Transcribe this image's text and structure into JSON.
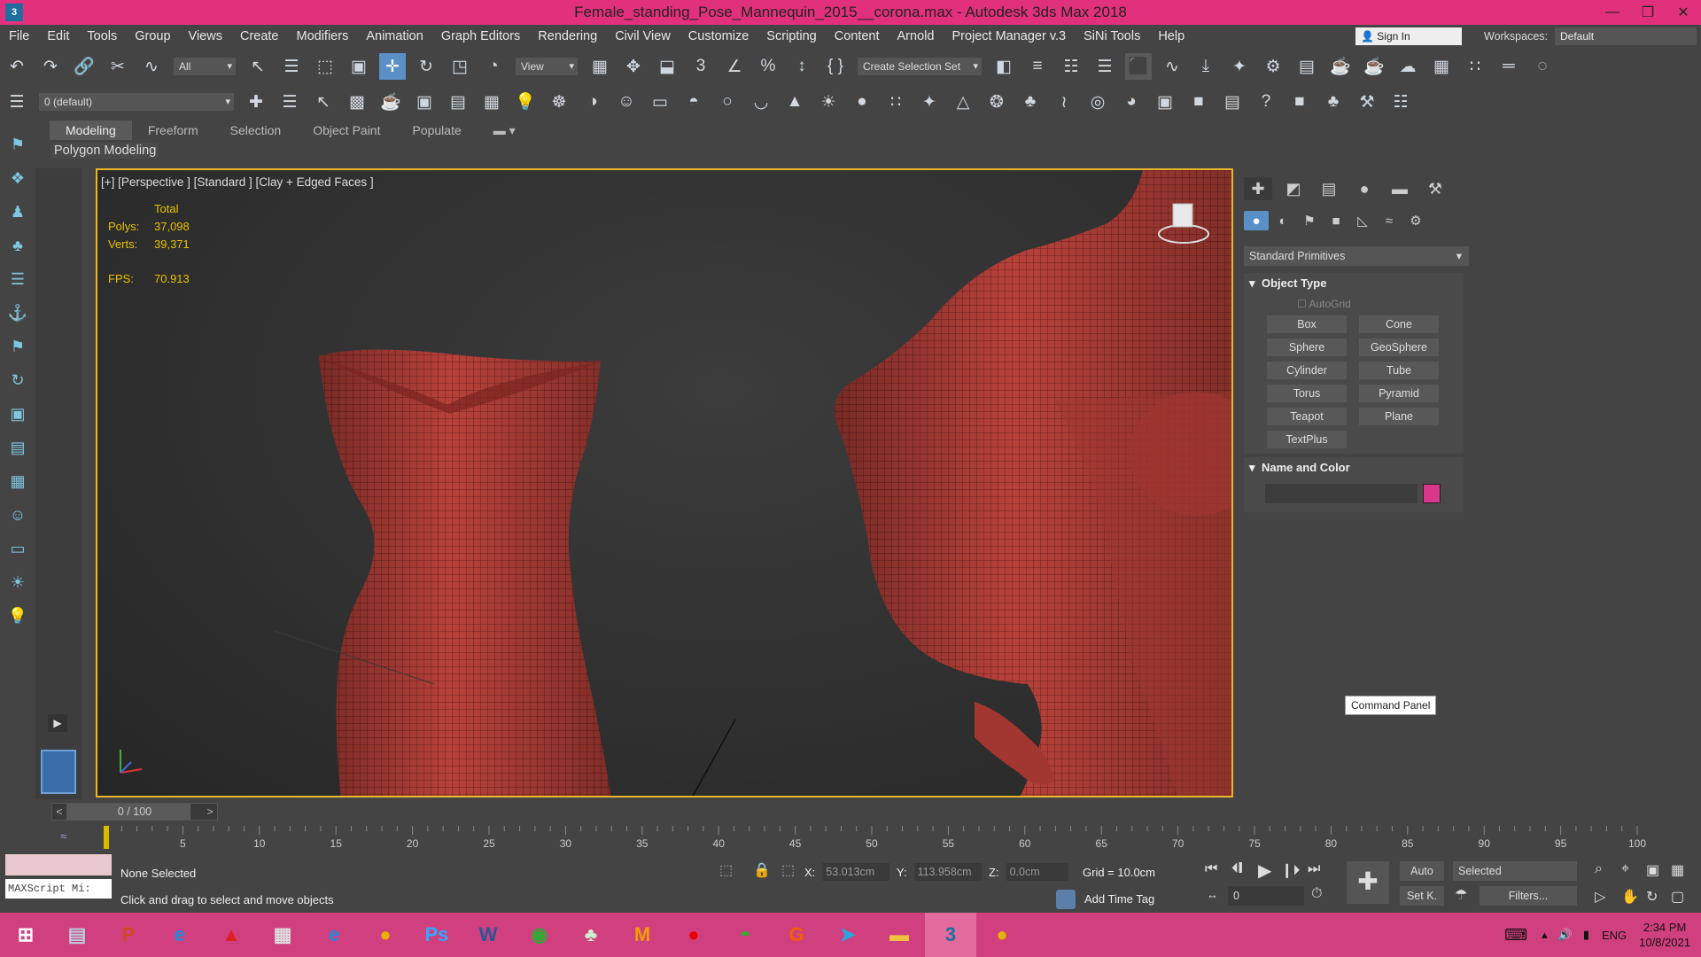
{
  "window": {
    "title": "Female_standing_Pose_Mannequin_2015__corona.max - Autodesk 3ds Max 2018",
    "app_icon": "3"
  },
  "menu": [
    "File",
    "Edit",
    "Tools",
    "Group",
    "Views",
    "Create",
    "Modifiers",
    "Animation",
    "Graph Editors",
    "Rendering",
    "Civil View",
    "Customize",
    "Scripting",
    "Content",
    "Arnold",
    "Project Manager v.3",
    "SiNi Tools",
    "Help"
  ],
  "signin": "Sign In",
  "workspaces": {
    "label": "Workspaces:",
    "value": "Default"
  },
  "toolbar": {
    "filter": "All",
    "refcoord": "View",
    "selset": "Create Selection Set",
    "layer": "0 (default)"
  },
  "ribbon": {
    "tabs": [
      "Modeling",
      "Freeform",
      "Selection",
      "Object Paint",
      "Populate"
    ],
    "active": "Modeling",
    "panel": "Polygon Modeling"
  },
  "viewport": {
    "label": "[+] [Perspective ] [Standard ] [Clay + Edged Faces ]",
    "stats_header": "Total",
    "polys_label": "Polys:",
    "polys": "37,098",
    "verts_label": "Verts:",
    "verts": "39,371",
    "fps_label": "FPS:",
    "fps": "70.913",
    "mesh_color": "#b8413a"
  },
  "command_panel": {
    "category": "Standard Primitives",
    "object_type_title": "Object Type",
    "autogrid": "AutoGrid",
    "buttons": [
      "Box",
      "Cone",
      "Sphere",
      "GeoSphere",
      "Cylinder",
      "Tube",
      "Torus",
      "Pyramid",
      "Teapot",
      "Plane",
      "TextPlus"
    ],
    "name_color_title": "Name and Color",
    "color_swatch": "#d8378a",
    "tooltip": "Command Panel"
  },
  "timeline": {
    "slider": "0 / 100",
    "ticks": [
      "5",
      "10",
      "15",
      "20",
      "25",
      "30",
      "35",
      "40",
      "45",
      "50",
      "55",
      "60",
      "65",
      "70",
      "75",
      "80",
      "85",
      "90",
      "95",
      "100"
    ]
  },
  "status": {
    "selection": "None Selected",
    "prompt": "Click and drag to select and move objects",
    "maxscript": "MAXScript Mi:",
    "x_label": "X:",
    "x": "53.013cm",
    "y_label": "Y:",
    "y": "113.958cm",
    "z_label": "Z:",
    "z": "0.0cm",
    "grid": "Grid = 10.0cm",
    "add_time_tag": "Add Time Tag",
    "auto": "Auto",
    "selected": "Selected",
    "setk": "Set K.",
    "filters": "Filters...",
    "frame": "0"
  },
  "taskbar": {
    "apps": [
      "explorer",
      "powerpoint",
      "ie",
      "acrobat",
      "calculator",
      "edge",
      "chrome",
      "photoshop",
      "word",
      "globe",
      "tree",
      "mendeley",
      "recorder",
      "android",
      "grammarly",
      "telegram",
      "folder",
      "3dsmax",
      "chrome2"
    ],
    "tray": {
      "lang": "ENG",
      "time": "2:34 PM",
      "date": "10/8/2021"
    }
  }
}
